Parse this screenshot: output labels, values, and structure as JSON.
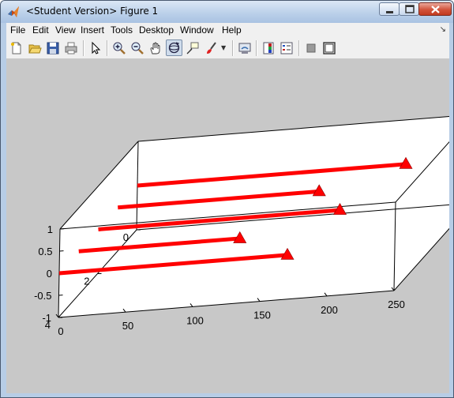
{
  "window": {
    "title": "<Student Version> Figure 1",
    "controls": [
      "minimize",
      "maximize",
      "close"
    ]
  },
  "menu": {
    "items": [
      "File",
      "Edit",
      "View",
      "Insert",
      "Tools",
      "Desktop",
      "Window",
      "Help"
    ],
    "dock_arrow": "↘"
  },
  "toolbar": {
    "buttons": [
      {
        "icon": "new-figure-icon"
      },
      {
        "icon": "open-file-icon"
      },
      {
        "icon": "save-icon"
      },
      {
        "icon": "print-icon"
      },
      {
        "icon": "select-arrow-icon"
      },
      {
        "icon": "zoom-in-icon"
      },
      {
        "icon": "zoom-out-icon"
      },
      {
        "icon": "pan-hand-icon"
      },
      {
        "icon": "rotate-3d-icon",
        "selected": true
      },
      {
        "icon": "data-cursor-icon"
      },
      {
        "icon": "brush-icon"
      },
      {
        "icon": "link-plot-icon"
      },
      {
        "icon": "colorbar-icon"
      },
      {
        "icon": "legend-icon"
      },
      {
        "icon": "hide-plot-tools-icon"
      },
      {
        "icon": "show-plot-tools-icon"
      }
    ]
  },
  "chart_data": {
    "type": "line",
    "view": "3d",
    "z_ticks": [
      "1",
      "0.5",
      "0",
      "-0.5",
      "-1"
    ],
    "y_ticks": [
      "0",
      "2",
      "4"
    ],
    "x_ticks": [
      "0",
      "50",
      "100",
      "150",
      "200",
      "250"
    ],
    "xlim": [
      0,
      250
    ],
    "ylim": [
      0,
      4
    ],
    "zlim": [
      -1,
      1
    ],
    "series_color": "#ff0000",
    "marker": "triangle",
    "series": [
      {
        "y": 0,
        "x_start": 0,
        "x_end": 200,
        "z": 0
      },
      {
        "y": 1,
        "x_start": 0,
        "x_end": 150,
        "z": 0
      },
      {
        "y": 2,
        "x_start": 0,
        "x_end": 180,
        "z": 0
      },
      {
        "y": 3,
        "x_start": 0,
        "x_end": 120,
        "z": 0
      },
      {
        "y": 4,
        "x_start": 0,
        "x_end": 170,
        "z": 0
      }
    ]
  }
}
